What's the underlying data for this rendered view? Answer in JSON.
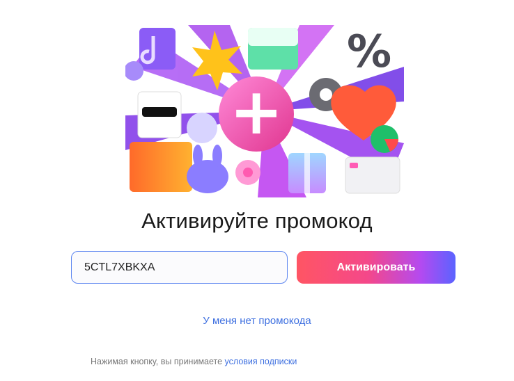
{
  "hero": {
    "plus_symbol": "+",
    "percent_symbol": "%"
  },
  "title": "Активируйте промокод",
  "promo_input": {
    "value": "5CTL7XBKXA",
    "placeholder": ""
  },
  "activate_button": {
    "label": "Активировать"
  },
  "no_code_link": {
    "label": "У меня нет промокода"
  },
  "legal": {
    "text": "Нажимая кнопку, вы принимаете",
    "link_label": "условия подписки"
  },
  "colors": {
    "link": "#3d6fe0",
    "input_border": "#5c85f0",
    "button_gradient": [
      "#ff5564",
      "#f4488a",
      "#b44af0",
      "#5b63ff"
    ]
  }
}
